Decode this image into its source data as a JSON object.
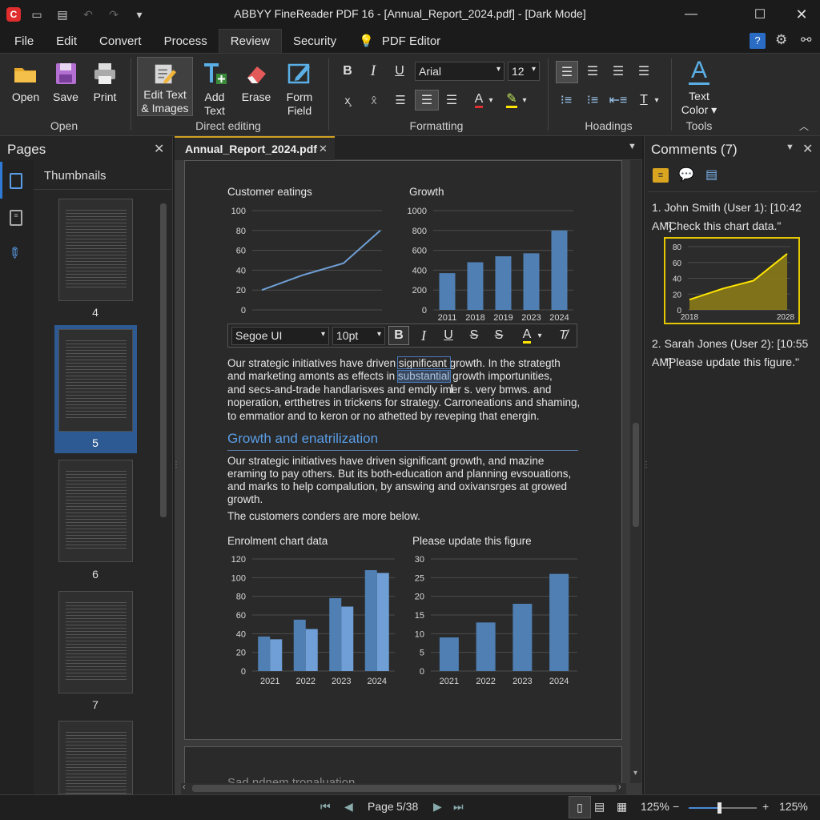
{
  "app": {
    "title": "ABBYY FineReader PDF 16 - [Annual_Report_2024.pdf] - [Dark Mode]"
  },
  "menus": [
    "File",
    "Edit",
    "Convert",
    "Process",
    "Review",
    "Security",
    "PDF Editor"
  ],
  "active_menu": "Review",
  "ribbon": {
    "open": {
      "open": "Open",
      "save": "Save",
      "print": "Print",
      "group": "Open"
    },
    "direct": {
      "edit_line1": "Edit Text",
      "edit_line2": "& Images",
      "add_line1": "Add",
      "add_line2": "Text",
      "erase": "Erase",
      "form_line1": "Form",
      "form_line2": "Field",
      "group": "Direct editing"
    },
    "formatting": {
      "font": "Arial",
      "size": "12",
      "group": "Formatting"
    },
    "headings": {
      "group": "Hoadings"
    },
    "tools": {
      "line1": "Text",
      "line2": "Color",
      "group": "Tools"
    }
  },
  "left_panel": {
    "title": "Pages",
    "thumbnails_label": "Thumbnails",
    "pages": [
      "4",
      "5",
      "6",
      "7"
    ],
    "selected_page": "5"
  },
  "document": {
    "tab": "Annual_Report_2024.pdf",
    "chart1_title": "Customer eatings",
    "chart2_title": "Growth",
    "floatbar": {
      "font": "Segoe UI",
      "size": "10pt"
    },
    "para1": [
      "Our strategic initiatives have driven significant growth. In the strategth",
      "and marketing amonts as effects in substantial growth importunities,",
      "and secs-and-trade handlarisxes and emdly imer s. very bmws. and",
      "noperation, ertthetres in trickens for strategy. Carroneations and shaming,",
      "to emmatior and to keron or no athetted by reveping that energin."
    ],
    "heading": "Growth and enatrilization",
    "para2": [
      "Our strategic initiatives have driven significant growth, and mazine",
      "eraming to pay others. But its both-education and planning evsouations,",
      "and marks to help compalution, by answing and oxivansrges at growed",
      "growth."
    ],
    "para3": "The customers conders are more below.",
    "chart3_title": "Enrolment chart data",
    "chart4_title": "Please update this figure",
    "page2_heading": "Sad ndnem tronaluation"
  },
  "chart_data": [
    {
      "type": "line",
      "title": "Customer eatings",
      "x": [
        1,
        2,
        3,
        4,
        5
      ],
      "values": [
        20,
        35,
        47,
        80
      ],
      "ylim": [
        0,
        100
      ],
      "yticks": [
        0,
        20,
        40,
        60,
        80,
        100
      ]
    },
    {
      "type": "bar",
      "title": "Growth",
      "categories": [
        "2011",
        "2018",
        "2019",
        "2023",
        "2024"
      ],
      "values": [
        370,
        480,
        540,
        570,
        800
      ],
      "ylim": [
        0,
        1000
      ],
      "yticks": [
        0,
        200,
        400,
        600,
        800,
        1000
      ]
    },
    {
      "type": "bar",
      "title": "Enrolment chart data",
      "categories": [
        "2021",
        "2022",
        "2023",
        "2024"
      ],
      "series": [
        {
          "values": [
            37,
            55,
            78,
            108
          ]
        },
        {
          "values": [
            34,
            45,
            69,
            105
          ]
        }
      ],
      "ylim": [
        0,
        120
      ],
      "yticks": [
        0,
        20,
        40,
        60,
        80,
        100,
        120
      ]
    },
    {
      "type": "bar",
      "title": "Please update this figure",
      "categories": [
        "2021",
        "2022",
        "2023",
        "2024"
      ],
      "values": [
        9,
        13,
        18,
        26
      ],
      "ylim": [
        0,
        30
      ],
      "yticks": [
        0,
        5,
        10,
        15,
        20,
        25,
        30
      ]
    },
    {
      "type": "area",
      "title": "",
      "categories": [
        "2018",
        "2028"
      ],
      "values": [
        13,
        27,
        37,
        71
      ],
      "ylim": [
        0,
        80
      ],
      "yticks": [
        0,
        20,
        40,
        60,
        80
      ]
    }
  ],
  "comments_panel": {
    "title": "Comments (7)",
    "c1_head": "1.  John Smith (User 1): [10:42 AM]",
    "c1_text": "\"Check this chart data.\"",
    "c2_head": "2.  Sarah Jones (User 2): [10:55 AM]",
    "c2_text": "\"Please update this figure.\""
  },
  "status": {
    "page_label": "Page",
    "page_value": "5/38",
    "zoom_left": "125%",
    "zoom_right": "125%",
    "zoom_fraction": 0.45
  },
  "colors": {
    "bar": "#4f7fb3",
    "bar_light": "#6f9fd6",
    "accent": "#2f66a8",
    "highlight": "#ffe600",
    "app_red": "#e02d2d"
  }
}
